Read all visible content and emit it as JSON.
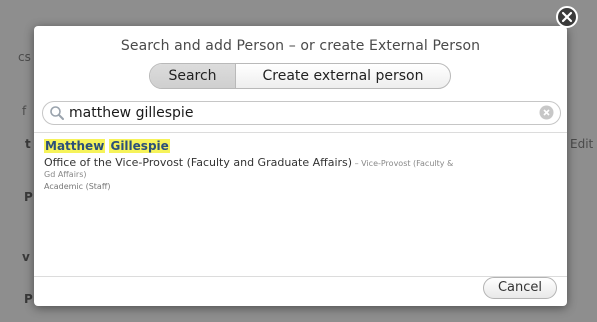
{
  "dialog": {
    "title": "Search and add Person – or create External Person",
    "tabs": [
      "Search",
      "Create external person"
    ],
    "search": {
      "value": "matthew gillespie",
      "placeholder": ""
    },
    "result": {
      "name_first": "Matthew",
      "name_last": "Gillespie",
      "department": "Office of the Vice-Provost (Faculty and Graduate Affairs)",
      "department_sub": " – Vice-Provost (Faculty &",
      "department_sub2": "Gd Affairs)",
      "role": "Academic (Staff)"
    },
    "cancel_label": "Cancel"
  },
  "background": {
    "fragments": [
      "t",
      "P",
      "v",
      "P",
      "Edit",
      "f",
      "cs"
    ]
  },
  "colors": {
    "highlight": "#f6f35a",
    "link": "#2b4f7a",
    "overlay": "#8e8e8e"
  }
}
